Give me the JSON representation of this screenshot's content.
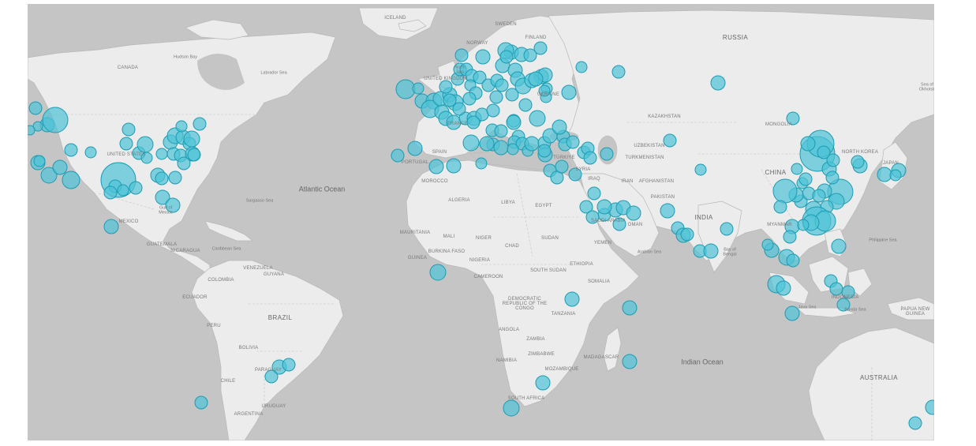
{
  "map": {
    "ocean_labels": [
      "Atlantic Ocean",
      "Indian Ocean"
    ],
    "country_labels": [
      "CANADA",
      "UNITED STATES",
      "MEXICO",
      "GUATEMALA",
      "NICARAGUA",
      "COLOMBIA",
      "VENEZUELA",
      "GUYANA",
      "ECUADOR",
      "PERU",
      "BRAZIL",
      "BOLIVIA",
      "PARAGUAY",
      "CHILE",
      "URUGUAY",
      "ARGENTINA",
      "ICELAND",
      "NORWAY",
      "SWEDEN",
      "FINLAND",
      "UNITED KINGDOM",
      "FRANCE",
      "SPAIN",
      "PORTUGAL",
      "MOROCCO",
      "ALGERIA",
      "LIBYA",
      "EGYPT",
      "MAURITANIA",
      "MALI",
      "NIGER",
      "CHAD",
      "SUDAN",
      "NIGERIA",
      "GUINEA",
      "BURKINA FASO",
      "CAMEROON",
      "SOUTH SUDAN",
      "ETHIOPIA",
      "SOMALIA",
      "DEMOCRATIC REPUBLIC OF THE CONGO",
      "TANZANIA",
      "ANGOLA",
      "ZAMBIA",
      "NAMIBIA",
      "ZIMBABWE",
      "MOZAMBIQUE",
      "MADAGASCAR",
      "SOUTH AFRICA",
      "TÜRKIYE",
      "IRAN",
      "IRAQ",
      "SYRIA",
      "SAUDI ARABIA",
      "OMAN",
      "YEMEN",
      "AFGHANISTAN",
      "PAKISTAN",
      "INDIA",
      "KAZAKHSTAN",
      "UZBEKISTAN",
      "TURKMENISTAN",
      "RUSSIA",
      "MONGOLIA",
      "CHINA",
      "MYANMAR",
      "NORTH KOREA",
      "JAPAN",
      "INDONESIA",
      "PAPUA NEW GUINEA",
      "AUSTRALIA",
      "UKRAINE"
    ],
    "sea_labels": [
      "Hudson Bay",
      "Labrador Sea",
      "Sargasso Sea",
      "Gulf of Mexico",
      "Caribbean Sea",
      "North Sea",
      "Arabian Sea",
      "Bay of Bengal",
      "Philippine Sea",
      "Sea of Okhotsk",
      "Java Sea",
      "Banda Sea"
    ]
  }
}
